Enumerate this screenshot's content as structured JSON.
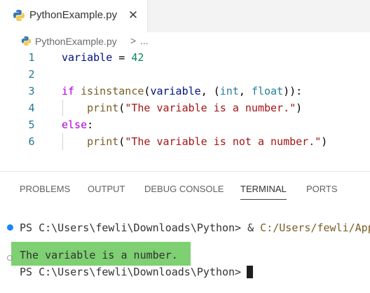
{
  "tab": {
    "filename": "PythonExample.py",
    "close_glyph": "✕"
  },
  "breadcrumb": {
    "file": "PythonExample.py",
    "separator": ">",
    "more": "..."
  },
  "editor": {
    "lines": [
      {
        "number": "1",
        "tokens": [
          "variable",
          " = ",
          "42"
        ]
      },
      {
        "number": "2",
        "tokens": []
      },
      {
        "number": "3",
        "tokens": [
          "if",
          " ",
          "isinstance",
          "(",
          "variable",
          ", (",
          "int",
          ", ",
          "float",
          ")):"
        ]
      },
      {
        "number": "4",
        "tokens": [
          "    ",
          "print",
          "(",
          "\"The variable is a number.\"",
          ")"
        ]
      },
      {
        "number": "5",
        "tokens": [
          "else",
          ":"
        ]
      },
      {
        "number": "6",
        "tokens": [
          "    ",
          "print",
          "(",
          "\"The variable is not a number.\"",
          ")"
        ]
      }
    ]
  },
  "panel": {
    "tabs": [
      "PROBLEMS",
      "OUTPUT",
      "DEBUG CONSOLE",
      "TERMINAL",
      "PORTS"
    ],
    "active_tab": "TERMINAL"
  },
  "terminal": {
    "prompt1": "PS C:\\Users\\fewli\\Downloads\\Python> & ",
    "command_path": "C:/Users/fewli/App",
    "output": "The variable is a number.",
    "prompt2": "PS C:\\Users\\fewli\\Downloads\\Python> "
  },
  "colors": {
    "keyword": "#af00db",
    "function": "#795e26",
    "type": "#267f99",
    "string": "#a31515",
    "number": "#098658",
    "variable": "#001080",
    "highlight": "#7ed072",
    "terminal_dot": "#1a85ff"
  },
  "icons": {
    "tab": "python-file-icon",
    "breadcrumb": "python-file-icon",
    "close": "close-icon"
  }
}
